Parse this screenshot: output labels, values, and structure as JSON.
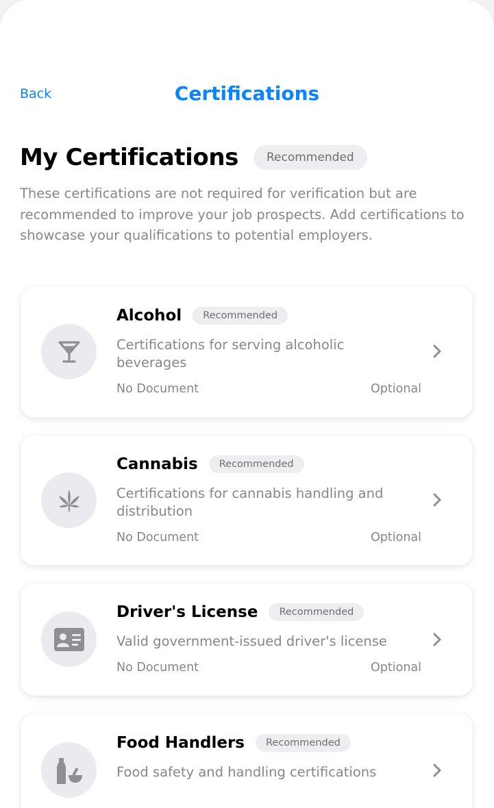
{
  "nav": {
    "back_label": "Back",
    "title": "Certifications"
  },
  "section": {
    "title": "My Certifications",
    "badge": "Recommended",
    "description": "These certifications are not required for verification but are recommended to improve your job prospects. Add certifications to showcase your qualifications to potential employers."
  },
  "colors": {
    "accent": "#0a84ff",
    "secondary_text": "#86868b",
    "badge_bg": "#eeeef1",
    "icon_gray": "#8e8e93"
  },
  "certifications": [
    {
      "title": "Alcohol",
      "badge": "Recommended",
      "description": "Certifications for serving alcoholic beverages",
      "document_status": "No Document",
      "requirement": "Optional",
      "icon": "cocktail-glass-icon"
    },
    {
      "title": "Cannabis",
      "badge": "Recommended",
      "description": "Certifications for cannabis handling and distribution",
      "document_status": "No Document",
      "requirement": "Optional",
      "icon": "cannabis-leaf-icon"
    },
    {
      "title": "Driver's License",
      "badge": "Recommended",
      "description": "Valid government-issued driver's license",
      "document_status": "No Document",
      "requirement": "Optional",
      "icon": "id-card-icon"
    },
    {
      "title": "Food Handlers",
      "badge": "Recommended",
      "description": "Food safety and handling certifications",
      "icon": "food-bottle-bowl-icon"
    }
  ]
}
